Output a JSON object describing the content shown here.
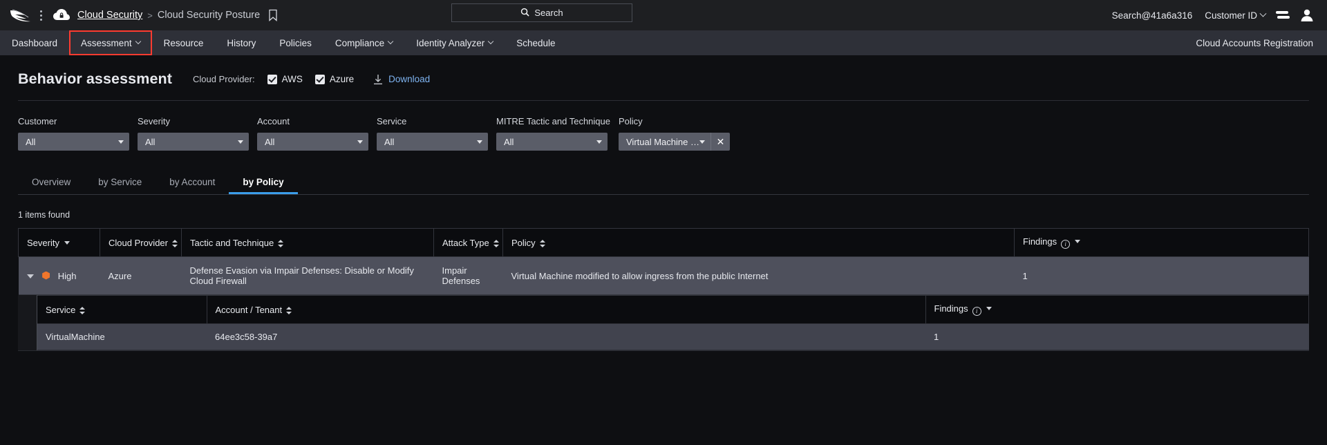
{
  "topbar": {
    "logo": "falcon-logo",
    "breadcrumb": {
      "root": "Cloud Security",
      "separator": ">",
      "current": "Cloud Security Posture"
    },
    "search": {
      "label": "Search",
      "icon": "search-icon"
    },
    "account": "Search@41a6a316",
    "customer_id": "Customer ID"
  },
  "nav": {
    "items": [
      {
        "label": "Dashboard",
        "caret": false,
        "highlighted": false
      },
      {
        "label": "Assessment",
        "caret": true,
        "highlighted": true
      },
      {
        "label": "Resource",
        "caret": false,
        "highlighted": false
      },
      {
        "label": "History",
        "caret": false,
        "highlighted": false
      },
      {
        "label": "Policies",
        "caret": false,
        "highlighted": false
      },
      {
        "label": "Compliance",
        "caret": true,
        "highlighted": false
      },
      {
        "label": "Identity Analyzer",
        "caret": true,
        "highlighted": false
      },
      {
        "label": "Schedule",
        "caret": false,
        "highlighted": false
      }
    ],
    "right_link": "Cloud Accounts Registration",
    "highlight_color": "#ff3b30"
  },
  "page": {
    "title": "Behavior assessment",
    "cloud_provider_label": "Cloud Provider:",
    "providers": [
      {
        "label": "AWS",
        "checked": true
      },
      {
        "label": "Azure",
        "checked": true
      }
    ],
    "download_label": "Download"
  },
  "filters": [
    {
      "label": "Customer",
      "value": "All",
      "clearable": false
    },
    {
      "label": "Severity",
      "value": "All",
      "clearable": false
    },
    {
      "label": "Account",
      "value": "All",
      "clearable": false
    },
    {
      "label": "Service",
      "value": "All",
      "clearable": false
    },
    {
      "label": "MITRE Tactic and Technique",
      "value": "All",
      "clearable": false
    },
    {
      "label": "Policy",
      "value": "Virtual Machine mo...",
      "clearable": true,
      "clear_label": "✕"
    }
  ],
  "tabs": [
    {
      "label": "Overview",
      "active": false
    },
    {
      "label": "by Service",
      "active": false
    },
    {
      "label": "by Account",
      "active": false
    },
    {
      "label": "by Policy",
      "active": true
    }
  ],
  "results": {
    "count_text": "1 items found",
    "columns": [
      {
        "label": "Severity",
        "sort": "caret"
      },
      {
        "label": "Cloud Provider",
        "sort": "updown"
      },
      {
        "label": "Tactic and Technique",
        "sort": "updown"
      },
      {
        "label": "Attack Type",
        "sort": "updown"
      },
      {
        "label": "Policy",
        "sort": "updown"
      },
      {
        "label": "Findings",
        "sort": "caret",
        "info": true
      }
    ],
    "rows": [
      {
        "expanded": true,
        "severity": "High",
        "severity_color": "#f0762c",
        "cloud_provider": "Azure",
        "tactic_and_technique": "Defense Evasion via Impair Defenses: Disable or Modify Cloud Firewall",
        "attack_type": "Impair Defenses",
        "policy": "Virtual Machine modified to allow ingress from the public Internet",
        "findings": "1",
        "sub": {
          "columns": [
            {
              "label": "Service",
              "sort": "updown"
            },
            {
              "label": "Account / Tenant",
              "sort": "updown"
            },
            {
              "label": "Findings",
              "sort": "caret",
              "info": true
            }
          ],
          "rows": [
            {
              "service": "VirtualMachine",
              "account_tenant": "64ee3c58-39a7",
              "findings": "1"
            }
          ]
        }
      }
    ]
  }
}
